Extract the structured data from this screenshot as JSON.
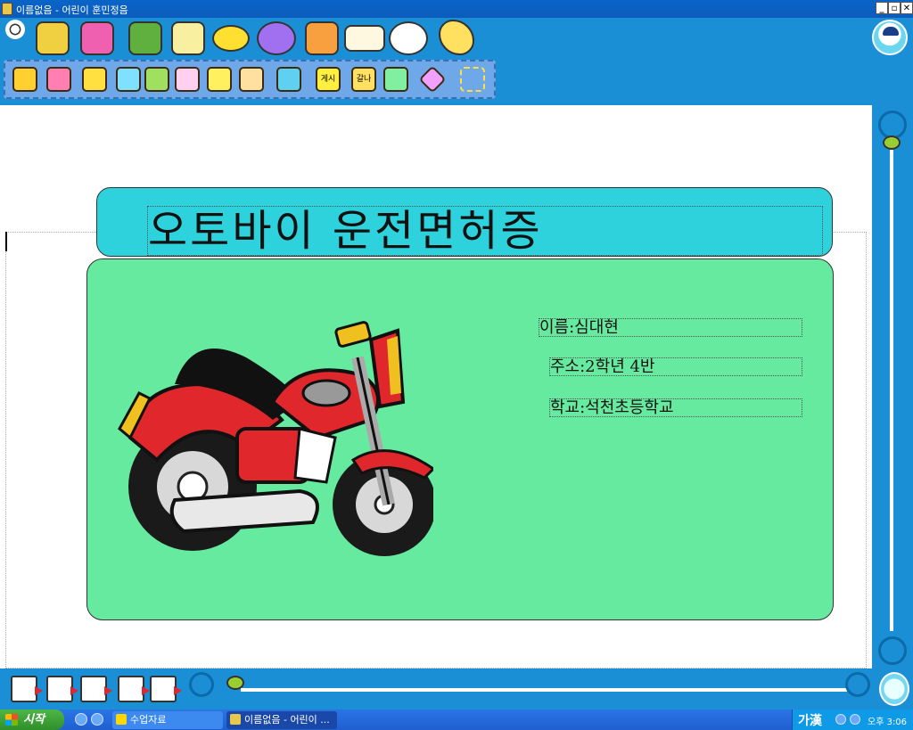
{
  "window": {
    "title": "이름없음 - 어린이 훈민정음",
    "controls": {
      "minimize": "_",
      "restore": "▫",
      "close": "✕"
    }
  },
  "toolbar_primary": {
    "icons": [
      "disc-icon",
      "cabinet-icon",
      "picture-card-icon",
      "gift-box-icon",
      "grid-sheet-icon",
      "paint-icon",
      "star-bubble-icon",
      "cards-icon",
      "open-book-icon",
      "magnifier-icon",
      "bird-icon"
    ]
  },
  "toolbar_format": {
    "icons": [
      "text-color-icon",
      "font-size-icon",
      "text-style-icon",
      "add-symbol-icon",
      "bold-text-icon",
      "special-char-icon",
      "text-box-icon",
      "pen-edit-icon",
      "frame-text-icon",
      "notice-text-icon",
      "hangul-box-icon",
      "page-layout-icon",
      "shapes-icon",
      "select-area-icon"
    ],
    "icon_labels": {
      "notice": "게시",
      "hangul": "갈나"
    }
  },
  "document": {
    "heading": "오토바이 운전면허증",
    "fields": {
      "name": "이름:심대현",
      "address": "주소:2학년  4반",
      "school": "학교:석천초등학교"
    },
    "colors": {
      "heading_panel": "#2ed2dc",
      "card": "#66ea9f"
    }
  },
  "bottom_toolbar": {
    "icons": [
      "page-prev-icon",
      "page-insert-icon",
      "page-copy-icon",
      "page-move-icon",
      "page-next-icon"
    ]
  },
  "taskbar": {
    "start_label": "시작",
    "tasks": [
      {
        "label": "수업자료"
      },
      {
        "label": "이름없음 - 어린이 ..."
      }
    ],
    "ime": "가漢",
    "clock": "오후 3:06"
  }
}
